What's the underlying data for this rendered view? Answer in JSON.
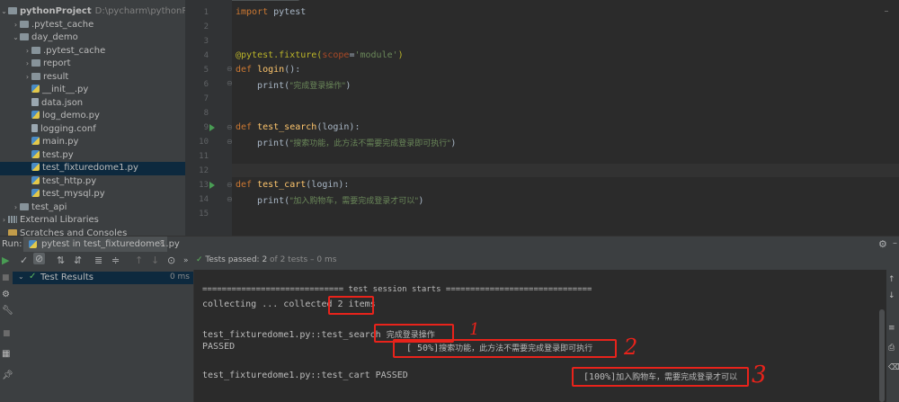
{
  "project": {
    "root_name": "pythonProject",
    "root_path": "D:\\pycharm\\pythonProject",
    "items": [
      {
        "label": ".pytest_cache",
        "kind": "folder",
        "depth": 1,
        "chev": "›"
      },
      {
        "label": "day_demo",
        "kind": "folder",
        "depth": 1,
        "chev": "⌄"
      },
      {
        "label": ".pytest_cache",
        "kind": "folder",
        "depth": 2,
        "chev": "›"
      },
      {
        "label": "report",
        "kind": "folder",
        "depth": 2,
        "chev": "›"
      },
      {
        "label": "result",
        "kind": "folder",
        "depth": 2,
        "chev": "›"
      },
      {
        "label": "__init__.py",
        "kind": "py",
        "depth": 2,
        "chev": ""
      },
      {
        "label": "data.json",
        "kind": "json",
        "depth": 2,
        "chev": ""
      },
      {
        "label": "log_demo.py",
        "kind": "py",
        "depth": 2,
        "chev": ""
      },
      {
        "label": "logging.conf",
        "kind": "conf",
        "depth": 2,
        "chev": ""
      },
      {
        "label": "main.py",
        "kind": "py",
        "depth": 2,
        "chev": ""
      },
      {
        "label": "test.py",
        "kind": "py",
        "depth": 2,
        "chev": ""
      },
      {
        "label": "test_fixturedome1.py",
        "kind": "py",
        "depth": 2,
        "chev": "",
        "selected": true
      },
      {
        "label": "test_http.py",
        "kind": "py",
        "depth": 2,
        "chev": ""
      },
      {
        "label": "test_mysql.py",
        "kind": "py",
        "depth": 2,
        "chev": ""
      },
      {
        "label": "test_api",
        "kind": "folder",
        "depth": 1,
        "chev": "›"
      },
      {
        "label": "External Libraries",
        "kind": "lib",
        "depth": 0,
        "chev": "›"
      },
      {
        "label": "Scratches and Consoles",
        "kind": "scratch",
        "depth": 0,
        "chev": ""
      }
    ]
  },
  "editor": {
    "line_numbers": [
      "1",
      "2",
      "3",
      "4",
      "5",
      "6",
      "7",
      "8",
      "9",
      "10",
      "11",
      "12",
      "13",
      "14",
      "15"
    ],
    "code": {
      "l1_kw": "import",
      "l1_rest": " pytest",
      "l4_deco": "@pytest.fixture(",
      "l4_param": "scope",
      "l4_eq": "=",
      "l4_str": "'module'",
      "l4_close": ")",
      "l5_kw": "def",
      "l5_fn": " login",
      "l5_rest": "():",
      "l6_print": "print(",
      "l6_str": "\"完成登录操作\"",
      "l6_close": ")",
      "l9_kw": "def",
      "l9_fn": " test_search",
      "l9_rest": "(login):",
      "l10_print": "print(",
      "l10_str": "\"搜索功能，此方法不需要完成登录即可执行\"",
      "l10_close": ")",
      "l13_kw": "def",
      "l13_fn": " test_cart",
      "l13_rest": "(login):",
      "l14_print": "print(",
      "l14_str": "\"加入购物车，需要完成登录才可以\"",
      "l14_close": ")"
    }
  },
  "run": {
    "label": "Run:",
    "tab_title": "pytest in test_fixturedome1.py",
    "status_bold": "Tests passed:",
    "status_count": " 2",
    "status_rest": " of 2 tests – 0 ms",
    "results_label": "Test Results",
    "results_time": "0 ms"
  },
  "console": {
    "line1": "============================= test session starts ==============================",
    "line2_pre": "collecting ... collected ",
    "line2_box": "2 items",
    "line3_pre": "test_fixturedome1.py::test_search ",
    "line3_box": "完成登录操作",
    "line4": "PASSED",
    "line4_box_pct": "[ 50%]",
    "line4_box_txt": "搜索功能，此方法不需要完成登录即可执行",
    "line5": "test_fixturedome1.py::test_cart PASSED",
    "line5_box_pct": "[100%]",
    "line5_box_txt": "加入购物车，需要完成登录才可以"
  },
  "annotations": {
    "a1": "1",
    "a2": "2",
    "a3": "3"
  },
  "colors": {
    "accent_red": "#e8231b",
    "pass_green": "#5fb85f",
    "selection": "#0d293e"
  }
}
